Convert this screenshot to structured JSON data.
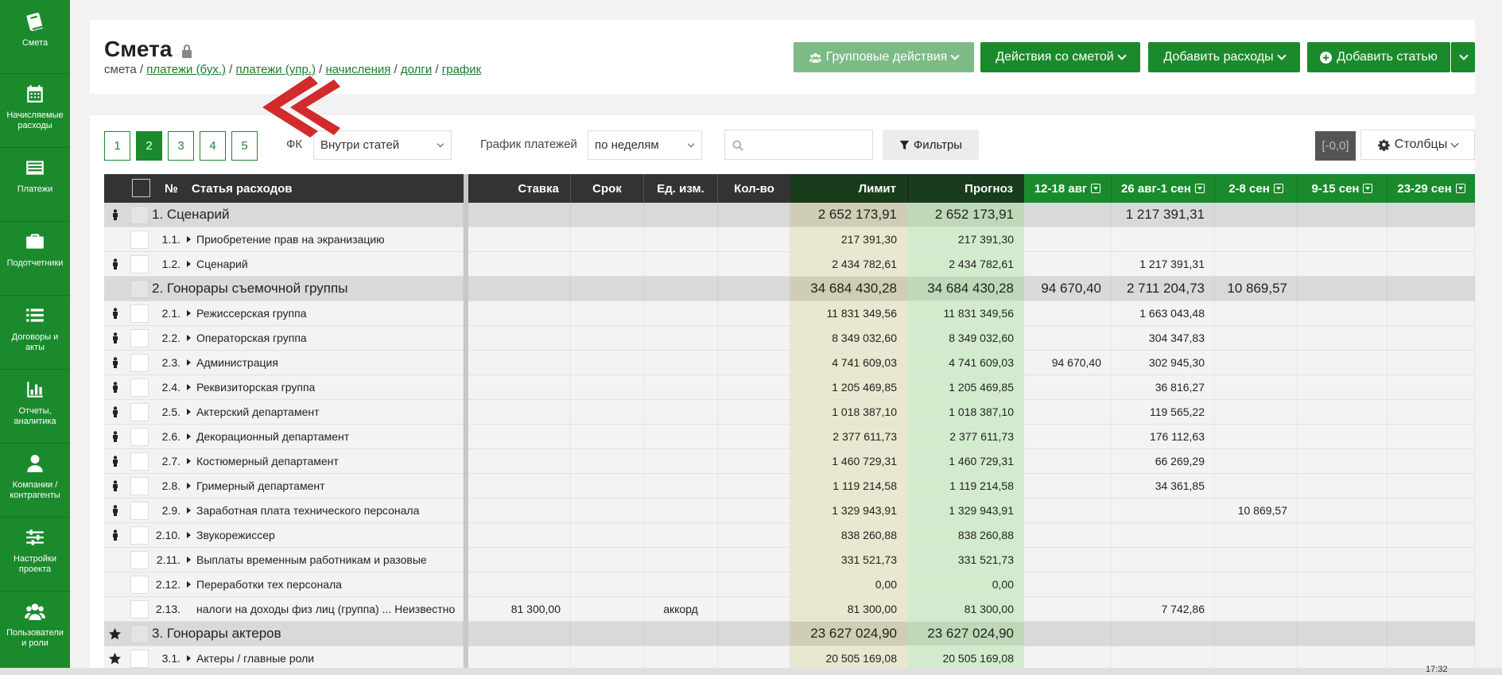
{
  "sidebar": {
    "items": [
      {
        "label": "Смета",
        "icon": "book-icon"
      },
      {
        "label": "Начисляемые расходы",
        "icon": "calendar-icon"
      },
      {
        "label": "Платежи",
        "icon": "list-icon"
      },
      {
        "label": "Подотчетники",
        "icon": "briefcase-icon"
      },
      {
        "label": "Договоры и акты",
        "icon": "list-bullets-icon"
      },
      {
        "label": "Отчеты, аналитика",
        "icon": "bar-chart-icon"
      },
      {
        "label": "Компании / контрагенты",
        "icon": "user-icon"
      },
      {
        "label": "Настройки проекта",
        "icon": "sliders-icon"
      },
      {
        "label": "Пользователи и роли",
        "icon": "users-icon"
      }
    ]
  },
  "header": {
    "title": "Смета",
    "breadcrumb": {
      "current": "смета",
      "links": [
        "платежи (бух.)",
        "платежи (упр.)",
        "начисления",
        "долги",
        "график"
      ]
    },
    "buttons": {
      "group_actions": "Групповые действия",
      "estimate_actions": "Действия со сметой",
      "add_expenses": "Добавить расходы",
      "add_item": "Добавить статью"
    }
  },
  "toolbar": {
    "pages": [
      "1",
      "2",
      "3",
      "4",
      "5"
    ],
    "fk_label": "ФК",
    "fk_value": "Внутри статей",
    "schedule_label": "График платежей",
    "schedule_value": "по неделям",
    "search_placeholder": "",
    "filters_label": "Фильтры",
    "zero_badge": "[-0,0]",
    "columns_label": "Столбцы"
  },
  "table": {
    "headers": {
      "num": "№",
      "name": "Статья расходов",
      "rate": "Ставка",
      "term": "Срок",
      "unit": "Ед. изм.",
      "qty": "Кол-во",
      "limit": "Лимит",
      "forecast": "Прогноз",
      "weeks": [
        "12-18 авг",
        "26 авг-1 сен",
        "2-8 сен",
        "9-15 сен",
        "23-29 сен"
      ]
    },
    "rows": [
      {
        "type": "group",
        "icon": "person",
        "num": "",
        "name": "1. Сценарий",
        "rate": "",
        "unit": "",
        "limit": "2 652 173,91",
        "forecast": "2 652 173,91",
        "w": [
          "",
          "1 217 391,31",
          "",
          "",
          ""
        ]
      },
      {
        "type": "item",
        "icon": "",
        "num": "1.1.",
        "name": "Приобретение прав на экранизацию",
        "arrow": true,
        "rate": "",
        "unit": "",
        "limit": "217 391,30",
        "forecast": "217 391,30",
        "w": [
          "",
          "",
          "",
          "",
          ""
        ]
      },
      {
        "type": "item",
        "icon": "person",
        "num": "1.2.",
        "name": "Сценарий",
        "arrow": true,
        "rate": "",
        "unit": "",
        "limit": "2 434 782,61",
        "forecast": "2 434 782,61",
        "w": [
          "",
          "1 217 391,31",
          "",
          "",
          ""
        ]
      },
      {
        "type": "group",
        "icon": "",
        "num": "",
        "name": "2. Гонорары съемочной группы",
        "rate": "",
        "unit": "",
        "limit": "34 684 430,28",
        "forecast": "34 684 430,28",
        "w": [
          "94 670,40",
          "2 711 204,73",
          "10 869,57",
          "",
          ""
        ]
      },
      {
        "type": "item",
        "icon": "person",
        "num": "2.1.",
        "name": "Режиссерская группа",
        "arrow": true,
        "rate": "",
        "unit": "",
        "limit": "11 831 349,56",
        "forecast": "11 831 349,56",
        "w": [
          "",
          "1 663 043,48",
          "",
          "",
          ""
        ]
      },
      {
        "type": "item",
        "icon": "person",
        "num": "2.2.",
        "name": "Операторская группа",
        "arrow": true,
        "rate": "",
        "unit": "",
        "limit": "8 349 032,60",
        "forecast": "8 349 032,60",
        "w": [
          "",
          "304 347,83",
          "",
          "",
          ""
        ]
      },
      {
        "type": "item",
        "icon": "person",
        "num": "2.3.",
        "name": "Администрация",
        "arrow": true,
        "rate": "",
        "unit": "",
        "limit": "4 741 609,03",
        "forecast": "4 741 609,03",
        "w": [
          "94 670,40",
          "302 945,30",
          "",
          "",
          ""
        ]
      },
      {
        "type": "item",
        "icon": "person",
        "num": "2.4.",
        "name": "Реквизиторская группа",
        "arrow": true,
        "rate": "",
        "unit": "",
        "limit": "1 205 469,85",
        "forecast": "1 205 469,85",
        "w": [
          "",
          "36 816,27",
          "",
          "",
          ""
        ]
      },
      {
        "type": "item",
        "icon": "person",
        "num": "2.5.",
        "name": "Актерский департамент",
        "arrow": true,
        "rate": "",
        "unit": "",
        "limit": "1 018 387,10",
        "forecast": "1 018 387,10",
        "w": [
          "",
          "119 565,22",
          "",
          "",
          ""
        ]
      },
      {
        "type": "item",
        "icon": "person",
        "num": "2.6.",
        "name": "Декорационный департамент",
        "arrow": true,
        "rate": "",
        "unit": "",
        "limit": "2 377 611,73",
        "forecast": "2 377 611,73",
        "w": [
          "",
          "176 112,63",
          "",
          "",
          ""
        ]
      },
      {
        "type": "item",
        "icon": "person",
        "num": "2.7.",
        "name": "Костюмерный департамент",
        "arrow": true,
        "rate": "",
        "unit": "",
        "limit": "1 460 729,31",
        "forecast": "1 460 729,31",
        "w": [
          "",
          "66 269,29",
          "",
          "",
          ""
        ]
      },
      {
        "type": "item",
        "icon": "person",
        "num": "2.8.",
        "name": "Гримерный департамент",
        "arrow": true,
        "rate": "",
        "unit": "",
        "limit": "1 119 214,58",
        "forecast": "1 119 214,58",
        "w": [
          "",
          "34 361,85",
          "",
          "",
          ""
        ]
      },
      {
        "type": "item",
        "icon": "person",
        "num": "2.9.",
        "name": "Заработная плата технического персонала",
        "arrow": true,
        "rate": "",
        "unit": "",
        "limit": "1 329 943,91",
        "forecast": "1 329 943,91",
        "w": [
          "",
          "",
          "10 869,57",
          "",
          ""
        ]
      },
      {
        "type": "item",
        "icon": "person",
        "num": "2.10.",
        "name": "Звукорежиссер",
        "arrow": true,
        "rate": "",
        "unit": "",
        "limit": "838 260,88",
        "forecast": "838 260,88",
        "w": [
          "",
          "",
          "",
          "",
          ""
        ]
      },
      {
        "type": "item",
        "icon": "",
        "num": "2.11.",
        "name": "Выплаты временным работникам и разовые",
        "arrow": true,
        "rate": "",
        "unit": "",
        "limit": "331 521,73",
        "forecast": "331 521,73",
        "w": [
          "",
          "",
          "",
          "",
          ""
        ]
      },
      {
        "type": "item",
        "icon": "",
        "num": "2.12.",
        "name": "Переработки тех персонала",
        "arrow": true,
        "rate": "",
        "unit": "",
        "limit": "0,00",
        "forecast": "0,00",
        "w": [
          "",
          "",
          "",
          "",
          ""
        ]
      },
      {
        "type": "item",
        "icon": "",
        "num": "2.13.",
        "name": "налоги на доходы физ лиц (группа) ... Неизвестно",
        "arrow": false,
        "rate": "81 300,00",
        "unit": "аккорд",
        "limit": "81 300,00",
        "forecast": "81 300,00",
        "w": [
          "",
          "7 742,86",
          "",
          "",
          ""
        ]
      },
      {
        "type": "group",
        "icon": "star",
        "num": "",
        "name": "3. Гонорары актеров",
        "rate": "",
        "unit": "",
        "limit": "23 627 024,90",
        "forecast": "23 627 024,90",
        "w": [
          "",
          "",
          "",
          "",
          ""
        ]
      },
      {
        "type": "item",
        "icon": "star",
        "num": "3.1.",
        "name": "Актеры / главные роли",
        "arrow": true,
        "rate": "",
        "unit": "",
        "limit": "20 505 169,08",
        "forecast": "20 505 169,08",
        "w": [
          "",
          "",
          "",
          "",
          ""
        ]
      }
    ]
  },
  "footer": {
    "time": "17:32"
  },
  "colors": {
    "brand_green": "#1b8a2c",
    "light_green": "#7dbb86",
    "dark_header": "#333333",
    "limit_bg": "#e8e7cf",
    "forecast_bg": "#d3ebcd",
    "arrow_red": "#d12b2b"
  }
}
